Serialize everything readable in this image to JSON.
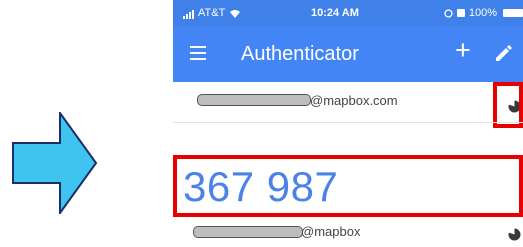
{
  "status_bar": {
    "carrier": "AT&T",
    "time": "10:24 AM",
    "battery": "100%"
  },
  "app_bar": {
    "title": "Authenticator",
    "add_label": "+"
  },
  "accounts": [
    {
      "email_suffix": "@mapbox.com"
    },
    {
      "code": "367 987",
      "email_suffix": "@mapbox"
    }
  ],
  "colors": {
    "app_bar": "#4385f4",
    "status_bar": "#3f81e9",
    "code_text": "#4c82e8",
    "highlight": "#e80000",
    "arrow_fill": "#3fc4ef"
  },
  "icons": [
    "right-arrow-icon",
    "wifi-icon",
    "alarm-icon",
    "menu-icon",
    "add-icon",
    "edit-icon",
    "timer-pie-icon"
  ]
}
